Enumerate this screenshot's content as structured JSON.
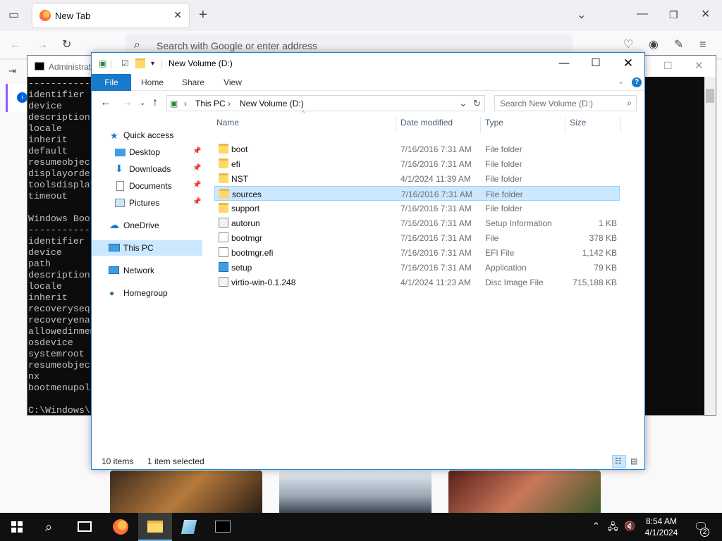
{
  "firefox": {
    "tab_title": "New Tab",
    "url_placeholder": "Search with Google or enter address"
  },
  "cmd": {
    "title": "Administrat",
    "lines": [
      "------------",
      "identifier",
      "device",
      "description",
      "locale",
      "inherit",
      "default",
      "resumeobject",
      "displayorder",
      "toolsdisplay",
      "timeout",
      "",
      "Windows Boot",
      "------------",
      "identifier",
      "device",
      "path",
      "description",
      "locale",
      "inherit",
      "recoveryseq",
      "recoveryenab",
      "allowedinmem",
      "osdevice",
      "systemroot",
      "resumeobject",
      "nx",
      "bootmenupoli",
      "",
      "C:\\Windows\\s"
    ]
  },
  "explorer": {
    "title": "New Volume (D:)",
    "ribbon_tabs": [
      "File",
      "Home",
      "Share",
      "View"
    ],
    "breadcrumb": [
      "This PC",
      "New Volume (D:)"
    ],
    "search_placeholder": "Search New Volume (D:)",
    "nav": {
      "quick_access": "Quick access",
      "desktop": "Desktop",
      "downloads": "Downloads",
      "documents": "Documents",
      "pictures": "Pictures",
      "onedrive": "OneDrive",
      "this_pc": "This PC",
      "network": "Network",
      "homegroup": "Homegroup"
    },
    "columns": {
      "name": "Name",
      "date": "Date modified",
      "type": "Type",
      "size": "Size"
    },
    "files": [
      {
        "name": "boot",
        "date": "7/16/2016 7:31 AM",
        "type": "File folder",
        "size": "",
        "icon": "folder-icon"
      },
      {
        "name": "efi",
        "date": "7/16/2016 7:31 AM",
        "type": "File folder",
        "size": "",
        "icon": "folder-icon"
      },
      {
        "name": "NST",
        "date": "4/1/2024 11:39 AM",
        "type": "File folder",
        "size": "",
        "icon": "folder-icon"
      },
      {
        "name": "sources",
        "date": "7/16/2016 7:31 AM",
        "type": "File folder",
        "size": "",
        "icon": "folder-icon"
      },
      {
        "name": "support",
        "date": "7/16/2016 7:31 AM",
        "type": "File folder",
        "size": "",
        "icon": "folder-icon"
      },
      {
        "name": "autorun",
        "date": "7/16/2016 7:31 AM",
        "type": "Setup Information",
        "size": "1 KB",
        "icon": "settings-file-icon"
      },
      {
        "name": "bootmgr",
        "date": "7/16/2016 7:31 AM",
        "type": "File",
        "size": "378 KB",
        "icon": "file-icon"
      },
      {
        "name": "bootmgr.efi",
        "date": "7/16/2016 7:31 AM",
        "type": "EFI File",
        "size": "1,142 KB",
        "icon": "file-icon"
      },
      {
        "name": "setup",
        "date": "7/16/2016 7:31 AM",
        "type": "Application",
        "size": "79 KB",
        "icon": "setup-icon"
      },
      {
        "name": "virtio-win-0.1.248",
        "date": "4/1/2024 11:23 AM",
        "type": "Disc Image File",
        "size": "715,188 KB",
        "icon": "disc-image-icon"
      }
    ],
    "status_items": "10 items",
    "status_selected": "1 item selected"
  },
  "taskbar": {
    "time": "8:54 AM",
    "date": "4/1/2024",
    "notification_count": "2"
  },
  "colors": {
    "accent": "#1979ca",
    "selection": "#cce8ff",
    "folder": "#ffd869"
  }
}
